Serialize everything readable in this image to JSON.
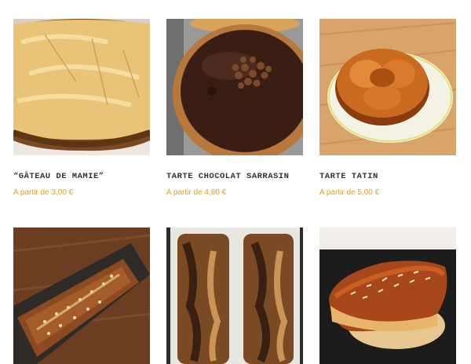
{
  "products": [
    {
      "name": "“Gâteau de Mamie”",
      "price": "A partir de 3,00 €",
      "image": "gateau-de-mamie"
    },
    {
      "name": "Tarte chocolat sarrasin",
      "price": "A partir de 4,80 €",
      "image": "tarte-chocolat"
    },
    {
      "name": "Tarte tatin",
      "price": "A partir de 5,00 €",
      "image": "tarte-tatin"
    },
    {
      "name": "",
      "price": "",
      "image": "cake-graines"
    },
    {
      "name": "",
      "price": "",
      "image": "cake-marbre"
    },
    {
      "name": "",
      "price": "",
      "image": "cake-amandes"
    }
  ],
  "colors": {
    "price": "#e3a21a",
    "title": "#333333"
  }
}
